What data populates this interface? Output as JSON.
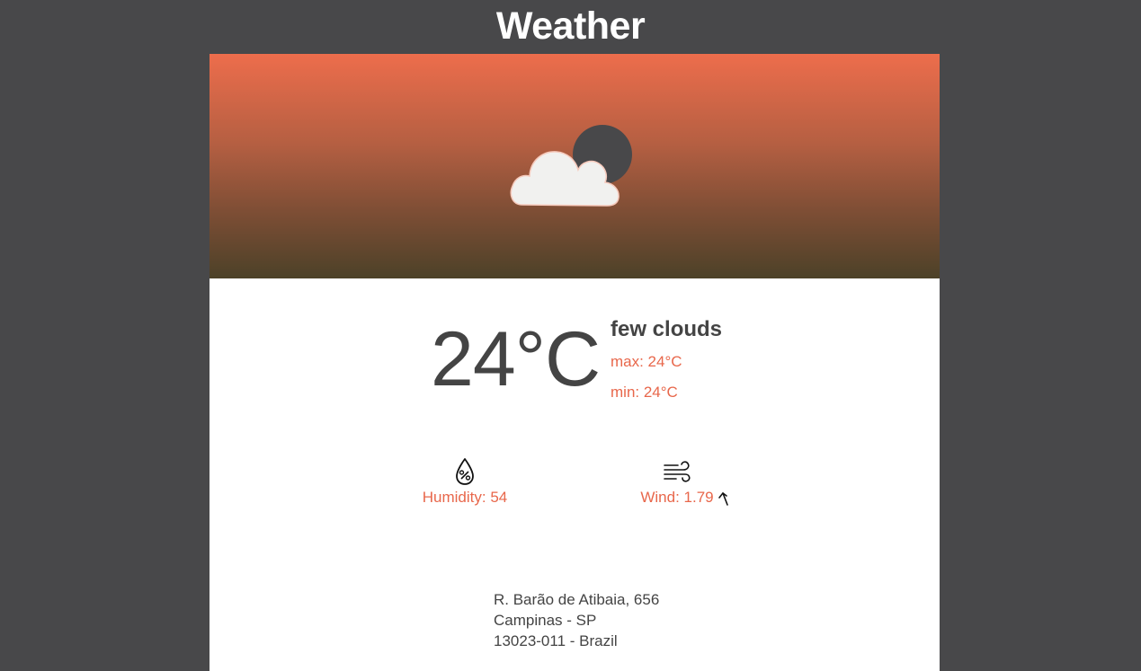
{
  "header": {
    "title": "Weather"
  },
  "weather": {
    "icon": "few-clouds-night-icon",
    "temperature": "24°C",
    "description": "few clouds",
    "max": "max: 24°C",
    "min": "min: 24°C"
  },
  "stats": {
    "humidity": {
      "icon": "humidity-icon",
      "label": "Humidity: 54"
    },
    "wind": {
      "icon": "wind-icon",
      "label": "Wind: 1.79",
      "direction_icon": "wind-direction-arrow-icon"
    }
  },
  "address": {
    "line1": "R. Barão de Atibaia, 656",
    "line2": "Campinas - SP",
    "line3": "13023-011 - Brazil"
  },
  "colors": {
    "background": "#48484a",
    "accent": "#e8674b",
    "banner_top": "#ed6d4c",
    "banner_bottom": "#4c4128",
    "text": "#444444"
  }
}
